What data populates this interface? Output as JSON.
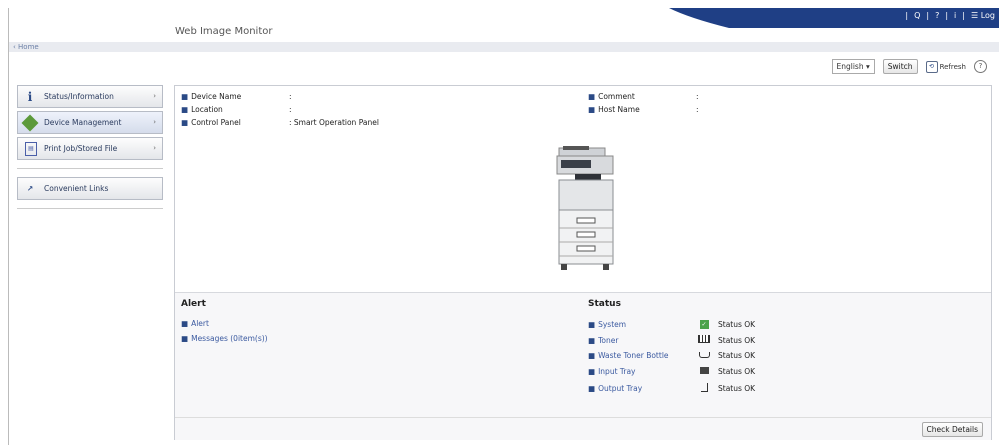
{
  "header": {
    "app_title": "Web Image Monitor",
    "tools": [
      "Q",
      "?",
      "i",
      "Log"
    ],
    "accent": "#1f3f85"
  },
  "breadcrumb": {
    "home": "‹ Home"
  },
  "toolbar": {
    "language": "English",
    "switch_label": "Switch",
    "refresh_label": "Refresh",
    "help_label": "?"
  },
  "sidebar": {
    "items": [
      {
        "label": "Status/Information",
        "icon": "info-icon"
      },
      {
        "label": "Device Management",
        "icon": "device-management-icon"
      },
      {
        "label": "Print Job/Stored File",
        "icon": "print-job-icon"
      }
    ],
    "links": {
      "label": "Convenient Links",
      "icon": "links-icon"
    }
  },
  "device": {
    "device_name_label": "Device Name",
    "device_name_value": ":",
    "location_label": "Location",
    "location_value": ":",
    "control_panel_label": "Control Panel",
    "control_panel_value": ": Smart Operation Panel",
    "comment_label": "Comment",
    "comment_value": ":",
    "host_name_label": "Host Name",
    "host_name_value": ":"
  },
  "alert": {
    "title": "Alert",
    "links": [
      "Alert",
      "Messages (0item(s))"
    ]
  },
  "status": {
    "title": "Status",
    "rows": [
      {
        "label": "System",
        "value": "Status OK",
        "icon": "system-ok-icon"
      },
      {
        "label": "Toner",
        "value": "Status OK",
        "icon": "toner-icon"
      },
      {
        "label": "Waste Toner Bottle",
        "value": "Status OK",
        "icon": "waste-toner-icon"
      },
      {
        "label": "Input Tray",
        "value": "Status OK",
        "icon": "input-tray-icon"
      },
      {
        "label": "Output Tray",
        "value": "Status OK",
        "icon": "output-tray-icon"
      }
    ]
  },
  "check_details_label": "Check Details"
}
